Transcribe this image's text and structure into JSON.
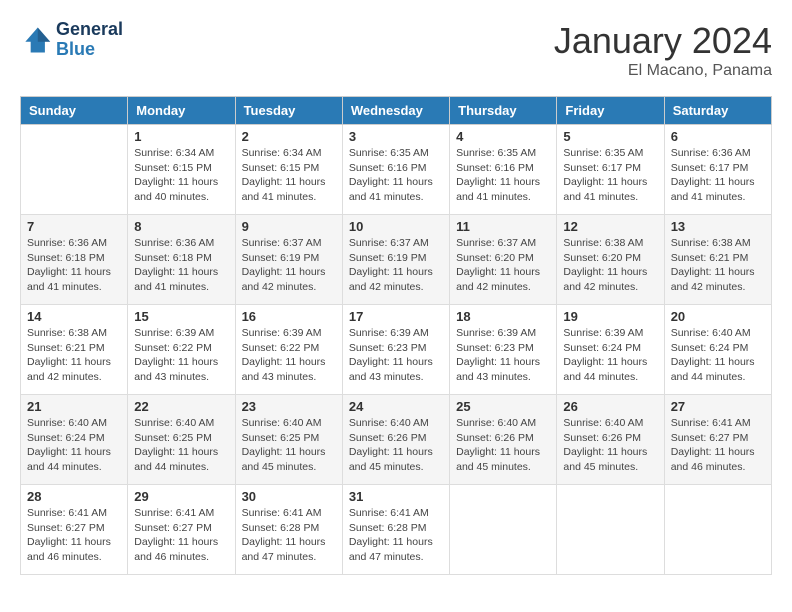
{
  "header": {
    "logo_line1": "General",
    "logo_line2": "Blue",
    "month": "January 2024",
    "location": "El Macano, Panama"
  },
  "days_of_week": [
    "Sunday",
    "Monday",
    "Tuesday",
    "Wednesday",
    "Thursday",
    "Friday",
    "Saturday"
  ],
  "weeks": [
    [
      {
        "day": "",
        "info": ""
      },
      {
        "day": "1",
        "info": "Sunrise: 6:34 AM\nSunset: 6:15 PM\nDaylight: 11 hours\nand 40 minutes."
      },
      {
        "day": "2",
        "info": "Sunrise: 6:34 AM\nSunset: 6:15 PM\nDaylight: 11 hours\nand 41 minutes."
      },
      {
        "day": "3",
        "info": "Sunrise: 6:35 AM\nSunset: 6:16 PM\nDaylight: 11 hours\nand 41 minutes."
      },
      {
        "day": "4",
        "info": "Sunrise: 6:35 AM\nSunset: 6:16 PM\nDaylight: 11 hours\nand 41 minutes."
      },
      {
        "day": "5",
        "info": "Sunrise: 6:35 AM\nSunset: 6:17 PM\nDaylight: 11 hours\nand 41 minutes."
      },
      {
        "day": "6",
        "info": "Sunrise: 6:36 AM\nSunset: 6:17 PM\nDaylight: 11 hours\nand 41 minutes."
      }
    ],
    [
      {
        "day": "7",
        "info": "Sunrise: 6:36 AM\nSunset: 6:18 PM\nDaylight: 11 hours\nand 41 minutes."
      },
      {
        "day": "8",
        "info": "Sunrise: 6:36 AM\nSunset: 6:18 PM\nDaylight: 11 hours\nand 41 minutes."
      },
      {
        "day": "9",
        "info": "Sunrise: 6:37 AM\nSunset: 6:19 PM\nDaylight: 11 hours\nand 42 minutes."
      },
      {
        "day": "10",
        "info": "Sunrise: 6:37 AM\nSunset: 6:19 PM\nDaylight: 11 hours\nand 42 minutes."
      },
      {
        "day": "11",
        "info": "Sunrise: 6:37 AM\nSunset: 6:20 PM\nDaylight: 11 hours\nand 42 minutes."
      },
      {
        "day": "12",
        "info": "Sunrise: 6:38 AM\nSunset: 6:20 PM\nDaylight: 11 hours\nand 42 minutes."
      },
      {
        "day": "13",
        "info": "Sunrise: 6:38 AM\nSunset: 6:21 PM\nDaylight: 11 hours\nand 42 minutes."
      }
    ],
    [
      {
        "day": "14",
        "info": "Sunrise: 6:38 AM\nSunset: 6:21 PM\nDaylight: 11 hours\nand 42 minutes."
      },
      {
        "day": "15",
        "info": "Sunrise: 6:39 AM\nSunset: 6:22 PM\nDaylight: 11 hours\nand 43 minutes."
      },
      {
        "day": "16",
        "info": "Sunrise: 6:39 AM\nSunset: 6:22 PM\nDaylight: 11 hours\nand 43 minutes."
      },
      {
        "day": "17",
        "info": "Sunrise: 6:39 AM\nSunset: 6:23 PM\nDaylight: 11 hours\nand 43 minutes."
      },
      {
        "day": "18",
        "info": "Sunrise: 6:39 AM\nSunset: 6:23 PM\nDaylight: 11 hours\nand 43 minutes."
      },
      {
        "day": "19",
        "info": "Sunrise: 6:39 AM\nSunset: 6:24 PM\nDaylight: 11 hours\nand 44 minutes."
      },
      {
        "day": "20",
        "info": "Sunrise: 6:40 AM\nSunset: 6:24 PM\nDaylight: 11 hours\nand 44 minutes."
      }
    ],
    [
      {
        "day": "21",
        "info": "Sunrise: 6:40 AM\nSunset: 6:24 PM\nDaylight: 11 hours\nand 44 minutes."
      },
      {
        "day": "22",
        "info": "Sunrise: 6:40 AM\nSunset: 6:25 PM\nDaylight: 11 hours\nand 44 minutes."
      },
      {
        "day": "23",
        "info": "Sunrise: 6:40 AM\nSunset: 6:25 PM\nDaylight: 11 hours\nand 45 minutes."
      },
      {
        "day": "24",
        "info": "Sunrise: 6:40 AM\nSunset: 6:26 PM\nDaylight: 11 hours\nand 45 minutes."
      },
      {
        "day": "25",
        "info": "Sunrise: 6:40 AM\nSunset: 6:26 PM\nDaylight: 11 hours\nand 45 minutes."
      },
      {
        "day": "26",
        "info": "Sunrise: 6:40 AM\nSunset: 6:26 PM\nDaylight: 11 hours\nand 45 minutes."
      },
      {
        "day": "27",
        "info": "Sunrise: 6:41 AM\nSunset: 6:27 PM\nDaylight: 11 hours\nand 46 minutes."
      }
    ],
    [
      {
        "day": "28",
        "info": "Sunrise: 6:41 AM\nSunset: 6:27 PM\nDaylight: 11 hours\nand 46 minutes."
      },
      {
        "day": "29",
        "info": "Sunrise: 6:41 AM\nSunset: 6:27 PM\nDaylight: 11 hours\nand 46 minutes."
      },
      {
        "day": "30",
        "info": "Sunrise: 6:41 AM\nSunset: 6:28 PM\nDaylight: 11 hours\nand 47 minutes."
      },
      {
        "day": "31",
        "info": "Sunrise: 6:41 AM\nSunset: 6:28 PM\nDaylight: 11 hours\nand 47 minutes."
      },
      {
        "day": "",
        "info": ""
      },
      {
        "day": "",
        "info": ""
      },
      {
        "day": "",
        "info": ""
      }
    ]
  ]
}
